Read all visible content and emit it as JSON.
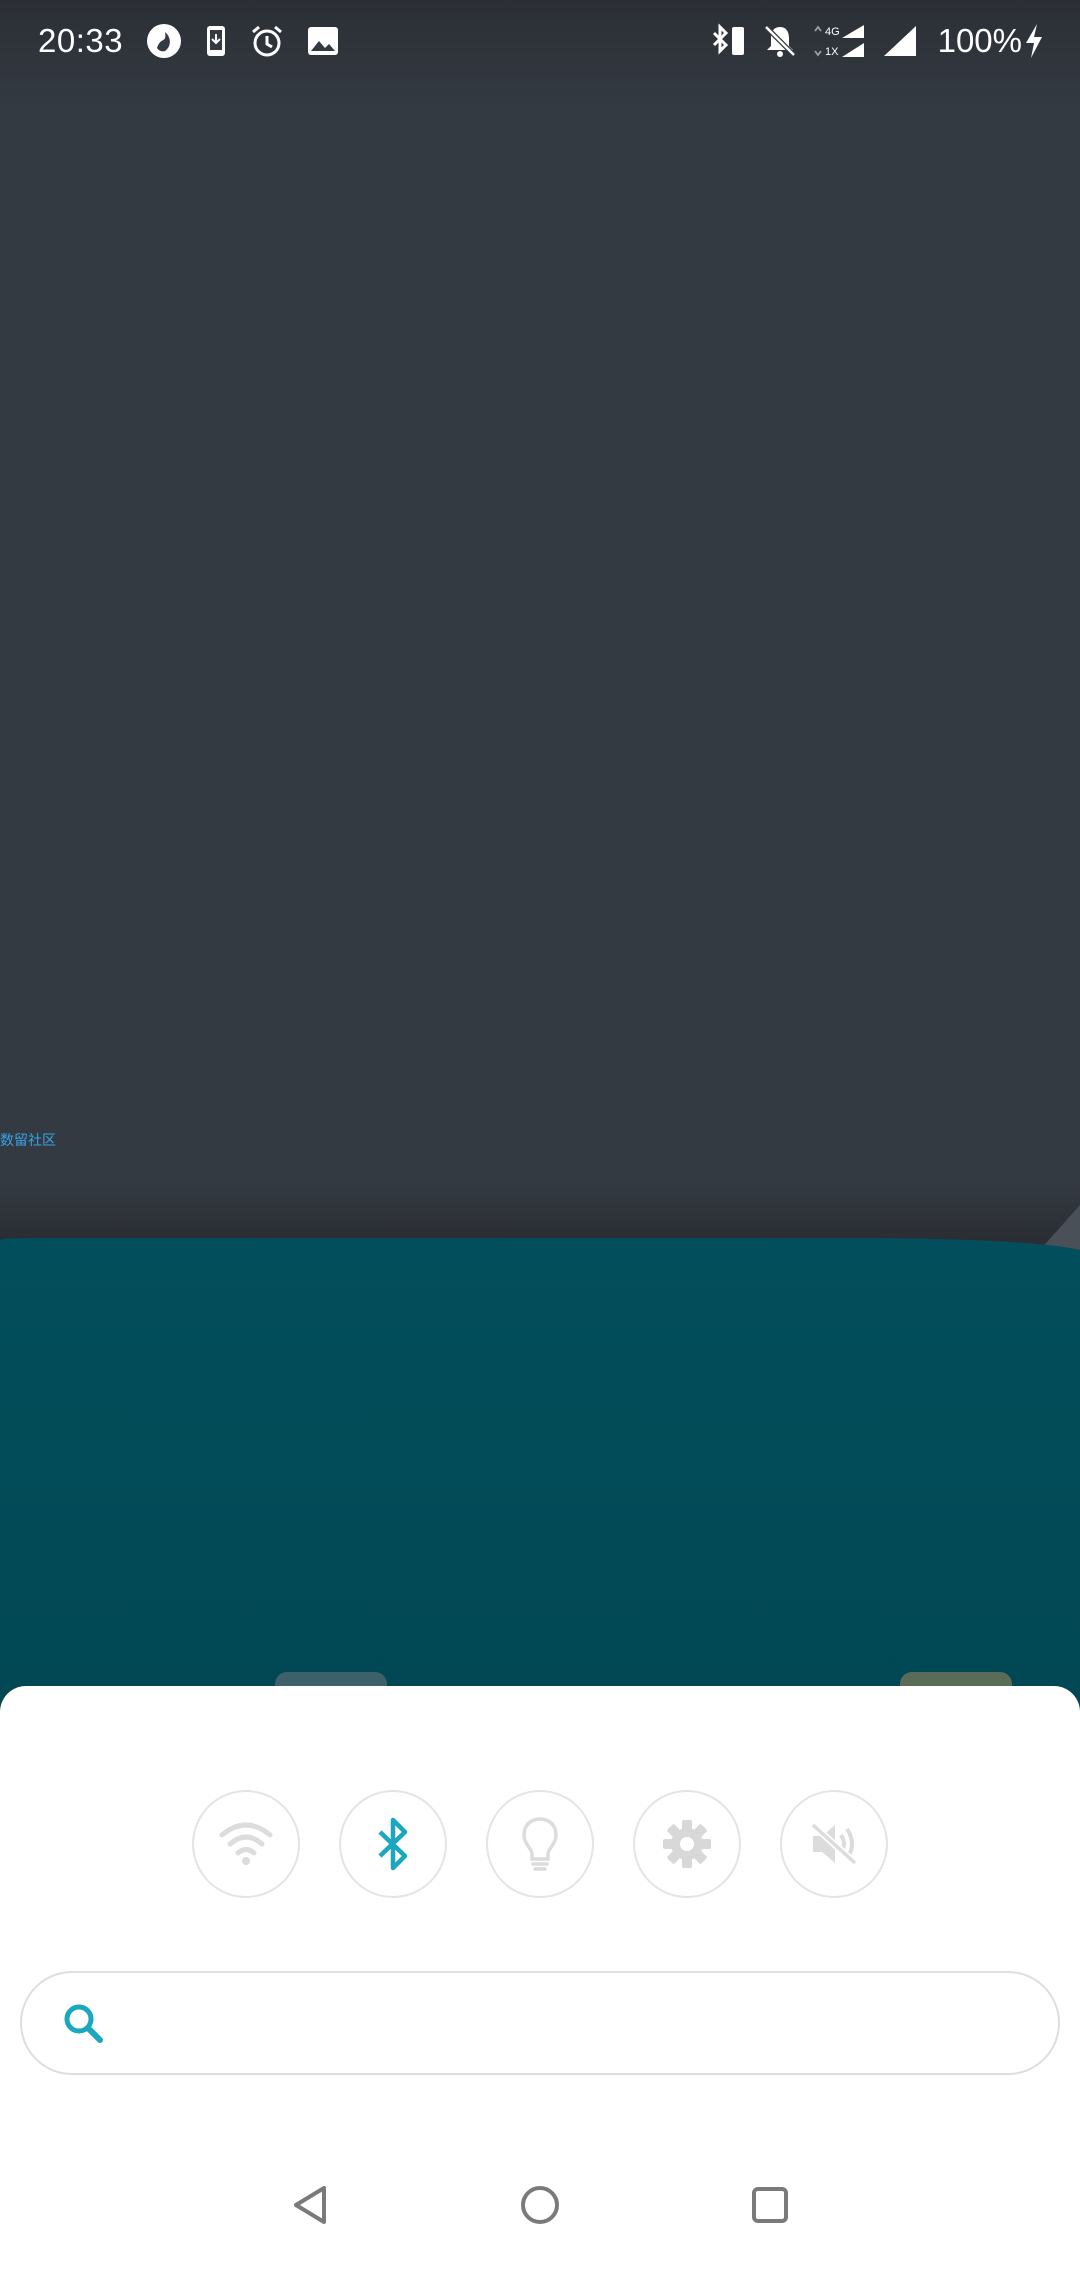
{
  "status_bar": {
    "time": "20:33",
    "battery": "100%",
    "left_icons": [
      "cloud-app-icon",
      "phone-download-icon",
      "alarm-icon",
      "image-icon"
    ],
    "right_icons": [
      "bluetooth-battery-icon",
      "notifications-off-icon",
      "mobile-data-4g-1x-icon",
      "signal-icon",
      "charging-icon"
    ],
    "network_labels": {
      "top": "4G",
      "bottom": "1X"
    }
  },
  "home": {
    "link_text": "数留社区"
  },
  "quick_toggles": [
    {
      "name": "wifi",
      "icon": "wifi-icon",
      "active": false
    },
    {
      "name": "bluetooth",
      "icon": "bluetooth-icon",
      "active": true
    },
    {
      "name": "flashlight",
      "icon": "lightbulb-icon",
      "active": false
    },
    {
      "name": "settings",
      "icon": "gear-icon",
      "active": false
    },
    {
      "name": "sound",
      "icon": "volume-mute-icon",
      "active": false
    }
  ],
  "search": {
    "placeholder": "",
    "value": "",
    "icon": "search-icon"
  },
  "nav": {
    "icons": [
      "back-triangle-icon",
      "home-circle-icon",
      "recents-square-icon"
    ]
  },
  "colors": {
    "background": "#343a42",
    "teal": "#024d5a",
    "accent": "#1aa7bf",
    "inactive_icon": "#dcdcdc",
    "nav_icon": "#7a7a7a"
  }
}
